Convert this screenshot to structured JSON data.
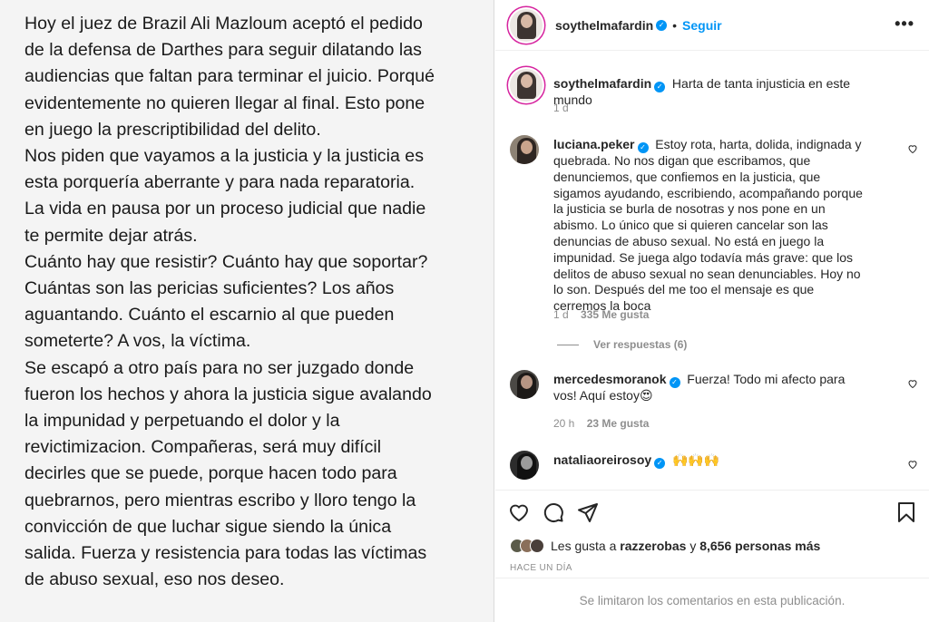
{
  "post_image": {
    "text": "Hoy el juez de Brazil Ali Mazloum aceptó el pedido\nde la defensa de Darthes para seguir dilatando las\naudiencias que faltan para terminar el juicio. Porqué\nevidentemente no quieren llegar al final. Esto pone\nen juego la prescriptibilidad del delito.\nNos piden que vayamos a la justicia y la justicia es\nesta porquería aberrante y para nada reparatoria.\nLa vida en pausa por un proceso judicial que nadie\nte permite dejar atrás.\nCuánto hay que resistir? Cuánto hay que soportar?\nCuántas son las pericias suficientes? Los años\naguantando. Cuánto el escarnio al que pueden\nsometerte? A vos, la víctima.\nSe escapó a otro país para no ser juzgado donde\nfueron los hechos y ahora la justicia sigue avalando\nla impunidad y perpetuando el dolor y la\nrevictimizacion. Compañeras, será muy difícil\ndecirles que se puede, porque hacen todo para\nquebrarnos, pero mientras escribo y lloro tengo la\nconvicción de que luchar sigue siendo la única\nsalida. Fuerza y resistencia para todas las víctimas\nde abuso sexual, eso nos deseo."
  },
  "header": {
    "username": "soythelmafardin",
    "separator": "•",
    "follow_label": "Seguir",
    "more_label": "•••"
  },
  "comments": [
    {
      "username": "soythelmafardin",
      "text": "Harta de tanta injusticia en este mundo",
      "time": "1 d"
    },
    {
      "username": "luciana.peker",
      "text": "Estoy rota, harta, dolida, indignada y quebrada. No nos digan que escribamos, que denunciemos, que confiemos en la justicia, que sigamos ayudando, escribiendo, acompañando porque la justicia se burla de nosotras y nos pone en un abismo. Lo único que si quieren cancelar son las denuncias de abuso sexual. No está en juego la impunidad. Se juega algo todavía más grave: que los delitos de abuso sexual no sean denunciables. Hoy no lo son. Después del me too el mensaje es que cerremos la boca",
      "time": "1 d",
      "likes": "335 Me gusta",
      "replies": "Ver respuestas (6)"
    },
    {
      "username": "mercedesmoranok",
      "text": "Fuerza! Todo mi afecto para vos! Aquí estoy😍",
      "time": "20 h",
      "likes": "23 Me gusta"
    },
    {
      "username": "nataliaoreirosoy",
      "text": "🙌🙌🙌"
    }
  ],
  "actions": {
    "icons": [
      "heart-icon",
      "comment-icon",
      "share-icon",
      "bookmark-icon"
    ]
  },
  "likes": {
    "prefix": "Les gusta a",
    "user": "razzerobas",
    "conj": "y",
    "count": "8,656 personas más"
  },
  "date": "HACE UN DÍA",
  "comments_limited": "Se limitaron los comentarios en esta publicación.",
  "colors": {
    "accent": "#0095f6",
    "muted": "#8e8e8e",
    "text": "#262626"
  }
}
